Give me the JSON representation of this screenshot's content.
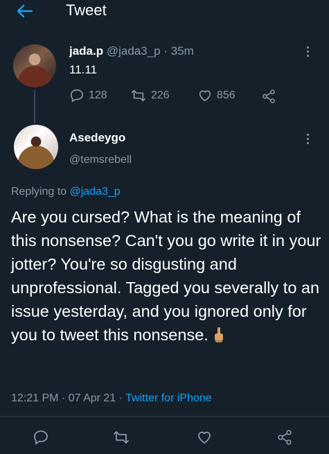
{
  "header": {
    "title": "Tweet",
    "back_icon": "arrow-left-icon"
  },
  "parent_tweet": {
    "name": "jada.p",
    "handle": "@jada3_p",
    "separator": "·",
    "time": "35m",
    "text": "11.11",
    "replies": "128",
    "retweets": "226",
    "likes": "856"
  },
  "reply_tweet": {
    "name": "Asedeygo",
    "handle": "@temsrebell",
    "replying_prefix": "Replying to",
    "replying_to": "@jada3_p",
    "text": "Are you cursed? What is the meaning of this nonsense? Can't you go write it in your jotter? You're so disgusting and unprofessional. Tagged you severally to an issue yesterday, and you ignored only for you to tweet this nonsense.",
    "time": "12:21 PM",
    "date": "07 Apr 21",
    "source": "Twitter for iPhone",
    "dot": "·"
  },
  "colors": {
    "background": "#15202b",
    "accent": "#1da1f2",
    "muted": "#8899a6"
  }
}
